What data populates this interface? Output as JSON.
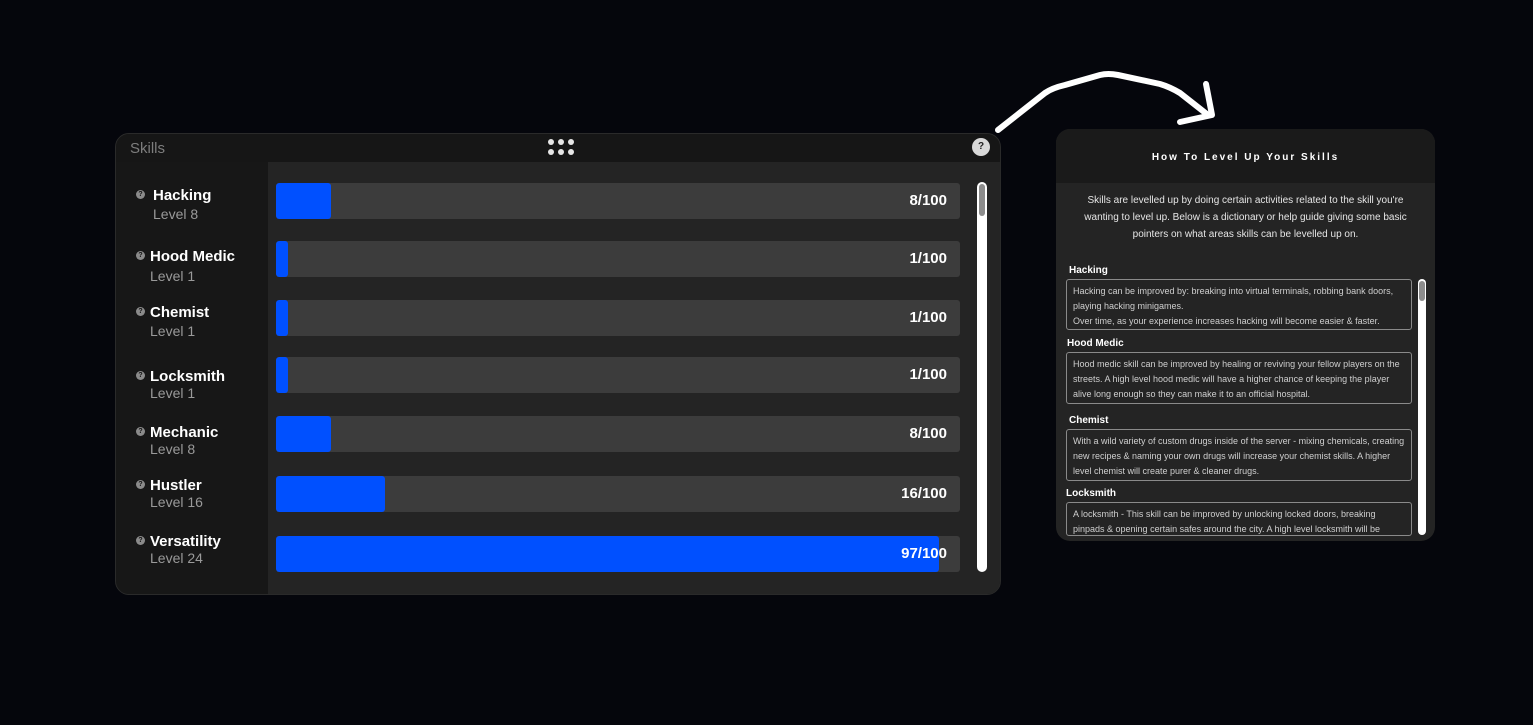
{
  "skills_panel": {
    "title": "Skills",
    "help_label": "?",
    "skills": [
      {
        "name": "Hacking",
        "level": "Level 8",
        "value": "8/100",
        "progress": 0.08
      },
      {
        "name": "Hood Medic",
        "level": "Level 1",
        "value": "1/100",
        "progress": 0.01
      },
      {
        "name": "Chemist",
        "level": "Level 1",
        "value": "1/100",
        "progress": 0.01
      },
      {
        "name": "Locksmith",
        "level": "Level 1",
        "value": "1/100",
        "progress": 0.01
      },
      {
        "name": "Mechanic",
        "level": "Level 8",
        "value": "8/100",
        "progress": 0.08
      },
      {
        "name": "Hustler",
        "level": "Level 16",
        "value": "16/100",
        "progress": 0.16
      },
      {
        "name": "Versatility",
        "level": "Level 24",
        "value": "97/100",
        "progress": 0.97
      }
    ]
  },
  "help_panel": {
    "title": "How To Level Up Your Skills",
    "intro": "Skills are levelled up by doing certain activities related to the skill you're wanting to level up. Below is a dictionary or help guide giving some basic pointers on what areas skills can be levelled up on.",
    "sections": [
      {
        "title": "Hacking",
        "text": "Hacking can be improved by: breaking into virtual terminals, robbing bank doors, playing hacking minigames.\nOver time, as your experience increases hacking will become easier & faster."
      },
      {
        "title": "Hood Medic",
        "text": "Hood medic skill can be improved by healing or reviving your fellow players on the streets. A high level hood medic will have a higher chance of keeping the player alive long enough so they can make it to an official hospital."
      },
      {
        "title": "Chemist",
        "text": "With a wild variety of custom drugs inside of the server - mixing chemicals, creating new recipes & naming your own drugs will increase your chemist skills. A higher level chemist will create purer & cleaner drugs."
      },
      {
        "title": "Locksmith",
        "text": "A locksmith - This skill can be improved by unlocking locked doors, breaking pinpads & opening certain safes around the city. A high level locksmith will be"
      }
    ]
  },
  "colors": {
    "accent": "#0050ff",
    "background": "#05060c",
    "panel": "#1b1b1b"
  }
}
